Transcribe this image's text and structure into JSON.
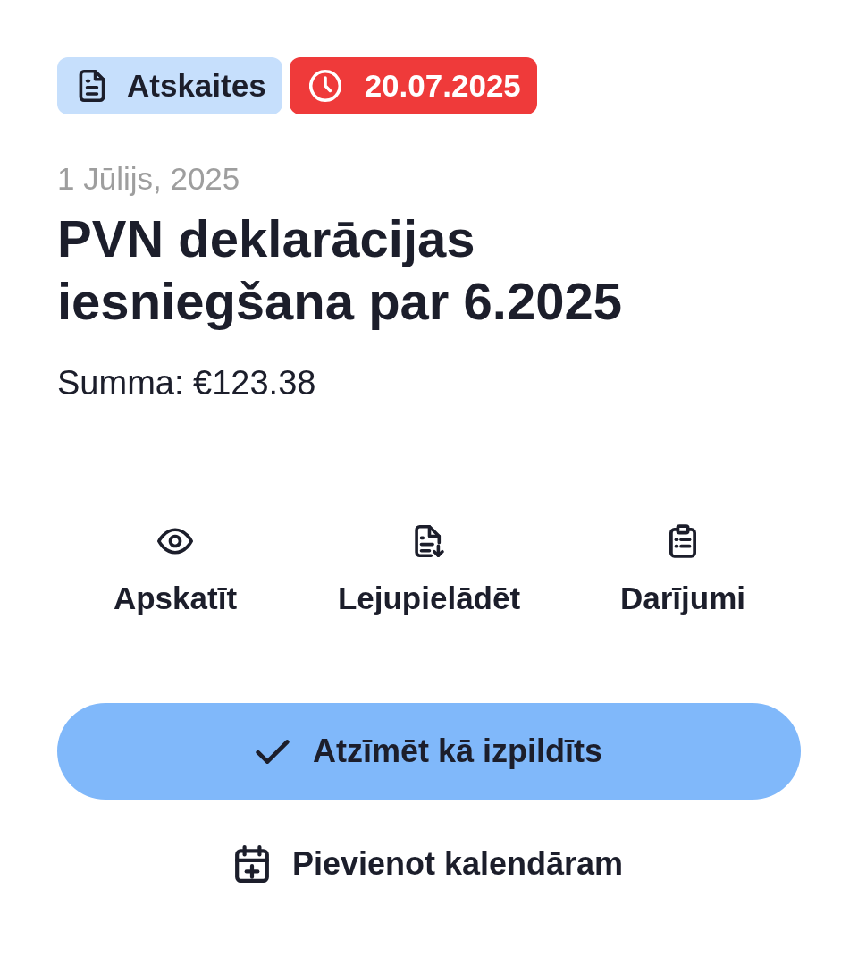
{
  "badges": [
    {
      "kind": "category",
      "label": "Atskaites"
    },
    {
      "kind": "deadline",
      "label": "20.07.2025"
    }
  ],
  "date": "1 Jūlijs, 2025",
  "title": "PVN deklarācijas iesniegšana par 6.2025",
  "amount": "Summa: €123.38",
  "actions": [
    {
      "kind": "view",
      "label": "Apskatīt"
    },
    {
      "kind": "download",
      "label": "Lejupielādēt"
    },
    {
      "kind": "transactions",
      "label": "Darījumi"
    }
  ],
  "primary_button": {
    "label": "Atzīmēt kā izpildīts"
  },
  "secondary_button": {
    "label": "Pievienot kalendāram"
  }
}
